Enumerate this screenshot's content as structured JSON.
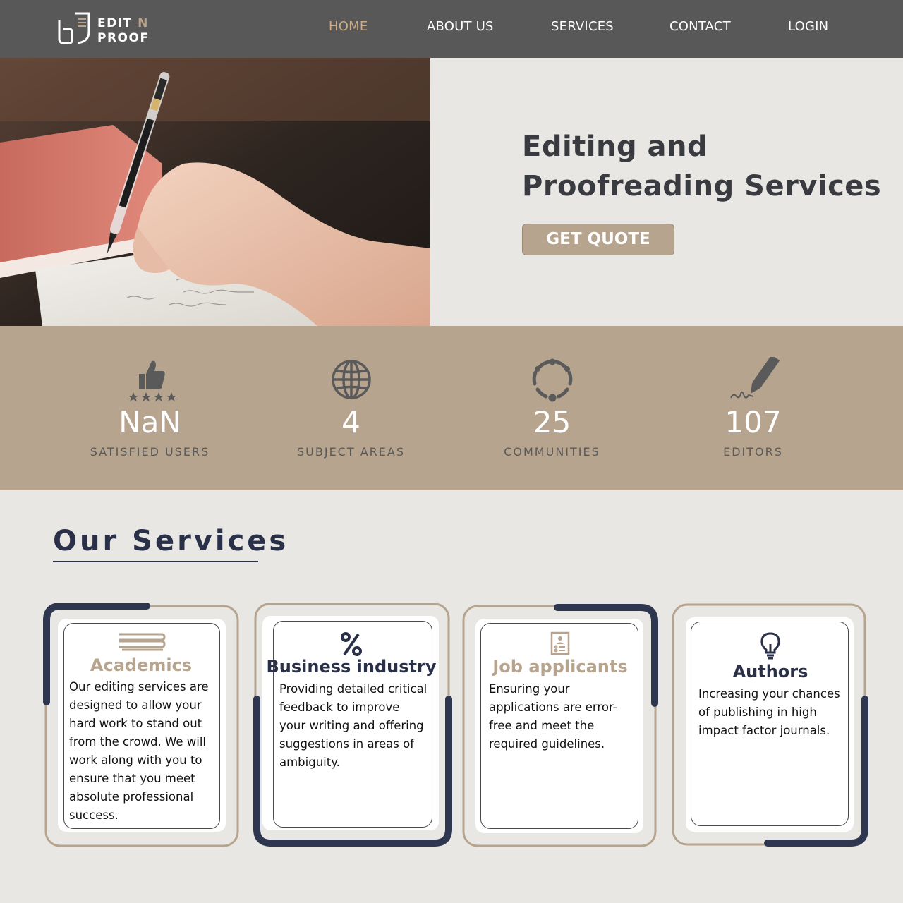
{
  "header": {
    "logo": {
      "line1": "EDIT ",
      "line1_accent": "N",
      "line2": "PROOF"
    },
    "nav": [
      {
        "label": "HOME",
        "active": true
      },
      {
        "label": "ABOUT US",
        "active": false
      },
      {
        "label": "SERVICES",
        "active": false
      },
      {
        "label": "CONTACT",
        "active": false
      },
      {
        "label": "LOGIN",
        "active": false
      }
    ]
  },
  "hero": {
    "title_line1": "Editing and",
    "title_line2": "Proofreading Services",
    "cta_label": "GET QUOTE",
    "image_icon": "hand-writing-with-pen-photo"
  },
  "stats": [
    {
      "icon": "thumbs-up-stars-icon",
      "value": "NaN",
      "label": "SATISFIED USERS"
    },
    {
      "icon": "globe-icon",
      "value": "4",
      "label": "SUBJECT AREAS"
    },
    {
      "icon": "dotted-circle-icon",
      "value": "25",
      "label": "COMMUNITIES"
    },
    {
      "icon": "pen-signature-icon",
      "value": "107",
      "label": "EDITORS"
    }
  ],
  "services": {
    "title": "Our Services",
    "cards": [
      {
        "icon": "books-icon",
        "title": "Academics",
        "description": "Our editing services are designed to allow your hard work to stand out from the crowd. We will work along with you to ensure that you meet absolute professional success."
      },
      {
        "icon": "percent-icon",
        "title": "Business industry",
        "description": "Providing detailed critical feedback to improve your writing and offering suggestions in areas of ambiguity."
      },
      {
        "icon": "resume-icon",
        "title": "Job applicants",
        "description": "Ensuring your applications are error-free and meet the required guidelines."
      },
      {
        "icon": "lightbulb-icon",
        "title": "Authors",
        "description": "Increasing your chances of publishing in high impact factor journals."
      }
    ]
  },
  "colors": {
    "header_bg": "#585858",
    "accent_tan": "#b6a48e",
    "navy": "#2a3048",
    "page_bg": "#e8e7e4"
  }
}
